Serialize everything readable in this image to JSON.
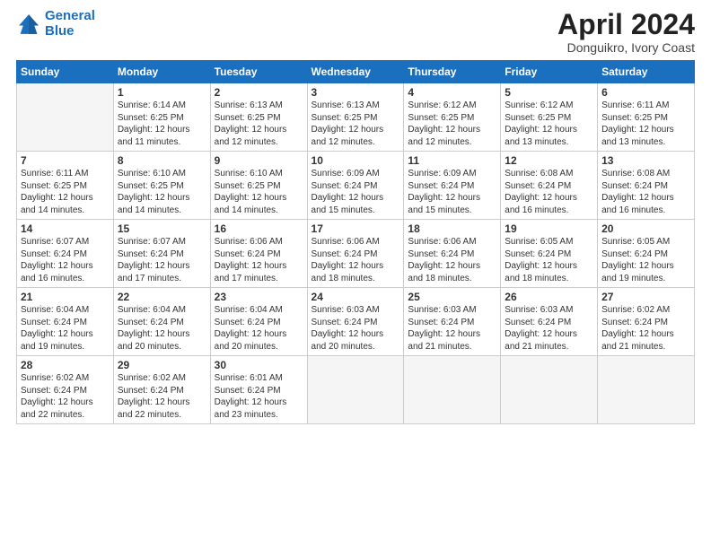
{
  "header": {
    "logo_line1": "General",
    "logo_line2": "Blue",
    "main_title": "April 2024",
    "subtitle": "Donguikro, Ivory Coast"
  },
  "days_of_week": [
    "Sunday",
    "Monday",
    "Tuesday",
    "Wednesday",
    "Thursday",
    "Friday",
    "Saturday"
  ],
  "weeks": [
    [
      {
        "day": "",
        "info": ""
      },
      {
        "day": "1",
        "info": "Sunrise: 6:14 AM\nSunset: 6:25 PM\nDaylight: 12 hours\nand 11 minutes."
      },
      {
        "day": "2",
        "info": "Sunrise: 6:13 AM\nSunset: 6:25 PM\nDaylight: 12 hours\nand 12 minutes."
      },
      {
        "day": "3",
        "info": "Sunrise: 6:13 AM\nSunset: 6:25 PM\nDaylight: 12 hours\nand 12 minutes."
      },
      {
        "day": "4",
        "info": "Sunrise: 6:12 AM\nSunset: 6:25 PM\nDaylight: 12 hours\nand 12 minutes."
      },
      {
        "day": "5",
        "info": "Sunrise: 6:12 AM\nSunset: 6:25 PM\nDaylight: 12 hours\nand 13 minutes."
      },
      {
        "day": "6",
        "info": "Sunrise: 6:11 AM\nSunset: 6:25 PM\nDaylight: 12 hours\nand 13 minutes."
      }
    ],
    [
      {
        "day": "7",
        "info": "Sunrise: 6:11 AM\nSunset: 6:25 PM\nDaylight: 12 hours\nand 14 minutes."
      },
      {
        "day": "8",
        "info": "Sunrise: 6:10 AM\nSunset: 6:25 PM\nDaylight: 12 hours\nand 14 minutes."
      },
      {
        "day": "9",
        "info": "Sunrise: 6:10 AM\nSunset: 6:25 PM\nDaylight: 12 hours\nand 14 minutes."
      },
      {
        "day": "10",
        "info": "Sunrise: 6:09 AM\nSunset: 6:24 PM\nDaylight: 12 hours\nand 15 minutes."
      },
      {
        "day": "11",
        "info": "Sunrise: 6:09 AM\nSunset: 6:24 PM\nDaylight: 12 hours\nand 15 minutes."
      },
      {
        "day": "12",
        "info": "Sunrise: 6:08 AM\nSunset: 6:24 PM\nDaylight: 12 hours\nand 16 minutes."
      },
      {
        "day": "13",
        "info": "Sunrise: 6:08 AM\nSunset: 6:24 PM\nDaylight: 12 hours\nand 16 minutes."
      }
    ],
    [
      {
        "day": "14",
        "info": "Sunrise: 6:07 AM\nSunset: 6:24 PM\nDaylight: 12 hours\nand 16 minutes."
      },
      {
        "day": "15",
        "info": "Sunrise: 6:07 AM\nSunset: 6:24 PM\nDaylight: 12 hours\nand 17 minutes."
      },
      {
        "day": "16",
        "info": "Sunrise: 6:06 AM\nSunset: 6:24 PM\nDaylight: 12 hours\nand 17 minutes."
      },
      {
        "day": "17",
        "info": "Sunrise: 6:06 AM\nSunset: 6:24 PM\nDaylight: 12 hours\nand 18 minutes."
      },
      {
        "day": "18",
        "info": "Sunrise: 6:06 AM\nSunset: 6:24 PM\nDaylight: 12 hours\nand 18 minutes."
      },
      {
        "day": "19",
        "info": "Sunrise: 6:05 AM\nSunset: 6:24 PM\nDaylight: 12 hours\nand 18 minutes."
      },
      {
        "day": "20",
        "info": "Sunrise: 6:05 AM\nSunset: 6:24 PM\nDaylight: 12 hours\nand 19 minutes."
      }
    ],
    [
      {
        "day": "21",
        "info": "Sunrise: 6:04 AM\nSunset: 6:24 PM\nDaylight: 12 hours\nand 19 minutes."
      },
      {
        "day": "22",
        "info": "Sunrise: 6:04 AM\nSunset: 6:24 PM\nDaylight: 12 hours\nand 20 minutes."
      },
      {
        "day": "23",
        "info": "Sunrise: 6:04 AM\nSunset: 6:24 PM\nDaylight: 12 hours\nand 20 minutes."
      },
      {
        "day": "24",
        "info": "Sunrise: 6:03 AM\nSunset: 6:24 PM\nDaylight: 12 hours\nand 20 minutes."
      },
      {
        "day": "25",
        "info": "Sunrise: 6:03 AM\nSunset: 6:24 PM\nDaylight: 12 hours\nand 21 minutes."
      },
      {
        "day": "26",
        "info": "Sunrise: 6:03 AM\nSunset: 6:24 PM\nDaylight: 12 hours\nand 21 minutes."
      },
      {
        "day": "27",
        "info": "Sunrise: 6:02 AM\nSunset: 6:24 PM\nDaylight: 12 hours\nand 21 minutes."
      }
    ],
    [
      {
        "day": "28",
        "info": "Sunrise: 6:02 AM\nSunset: 6:24 PM\nDaylight: 12 hours\nand 22 minutes."
      },
      {
        "day": "29",
        "info": "Sunrise: 6:02 AM\nSunset: 6:24 PM\nDaylight: 12 hours\nand 22 minutes."
      },
      {
        "day": "30",
        "info": "Sunrise: 6:01 AM\nSunset: 6:24 PM\nDaylight: 12 hours\nand 23 minutes."
      },
      {
        "day": "",
        "info": ""
      },
      {
        "day": "",
        "info": ""
      },
      {
        "day": "",
        "info": ""
      },
      {
        "day": "",
        "info": ""
      }
    ]
  ]
}
